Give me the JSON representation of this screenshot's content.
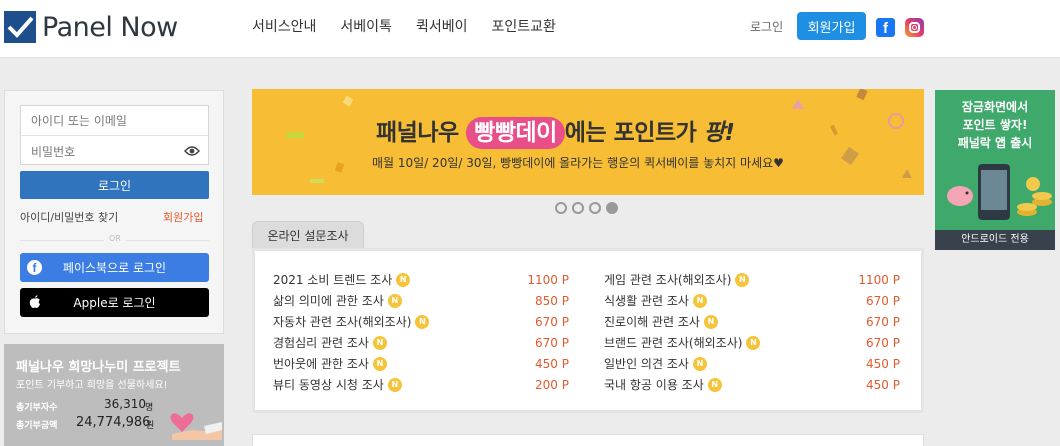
{
  "header": {
    "logo_text": "Panel Now",
    "nav": [
      "서비스안내",
      "서베이톡",
      "퀵서베이",
      "포인트교환"
    ],
    "login": "로그인",
    "signup": "회원가입"
  },
  "login_panel": {
    "id_placeholder": "아이디 또는 이메일",
    "pw_placeholder": "비밀번호",
    "login_button": "로그인",
    "find_link": "아이디/비밀번호 찾기",
    "join_link": "회원가입",
    "or_text": "OR",
    "facebook_button": "페이스북으로 로그인",
    "apple_button": "Apple로 로그인"
  },
  "donation": {
    "title": "패널나우 희망나누미 프로젝트",
    "subtitle": "포인트 기부하고 희망을 선물하세요!",
    "donors_label": "총기부자수",
    "donors_value": "36,310",
    "donors_unit": "명",
    "amount_label": "총기부금액",
    "amount_value": "24,774,986",
    "amount_unit": "원"
  },
  "banner": {
    "title_pre": "패널나우",
    "title_pill": "빵빵데이",
    "title_mid": "에는 포인트가",
    "title_end": "팡!",
    "subtitle": "매월 10일/ 20일/ 30일, 빵빵데이에 올라가는 행운의 퀵서베이를 놓치지 마세요♥"
  },
  "survey": {
    "tab_label": "온라인 설문조사",
    "badge": "N",
    "left": [
      {
        "title": "2021 소비 트렌드 조사",
        "points": "1100 P"
      },
      {
        "title": "삶의 의미에 관한 조사",
        "points": "850 P"
      },
      {
        "title": "자동차 관련 조사(해외조사)",
        "points": "670 P"
      },
      {
        "title": "경험심리 관련 조사",
        "points": "670 P"
      },
      {
        "title": "번아웃에 관한 조사",
        "points": "450 P"
      },
      {
        "title": "뷰티 동영상 시청 조사",
        "points": "200 P"
      }
    ],
    "right": [
      {
        "title": "게임 관련 조사(해외조사)",
        "points": "1100 P"
      },
      {
        "title": "식생활 관련 조사",
        "points": "670 P"
      },
      {
        "title": "진로이해 관련 조사",
        "points": "670 P"
      },
      {
        "title": "브랜드 관련 조사(해외조사)",
        "points": "670 P"
      },
      {
        "title": "일반인 의견 조사",
        "points": "450 P"
      },
      {
        "title": "국내 항공 이용 조사",
        "points": "450 P"
      }
    ]
  },
  "app_ad": {
    "line1": "잠금화면에서",
    "line2": "포인트 쌓자!",
    "line3": "패널락 앱 출시",
    "footer": "안드로이드 전용"
  },
  "colors": {
    "primary": "#2f74bd",
    "signup": "#1e8fe3",
    "points": "#e25a2d",
    "banner": "#f7bd35",
    "pill": "#e84e88",
    "app_ad": "#3fa86b"
  }
}
